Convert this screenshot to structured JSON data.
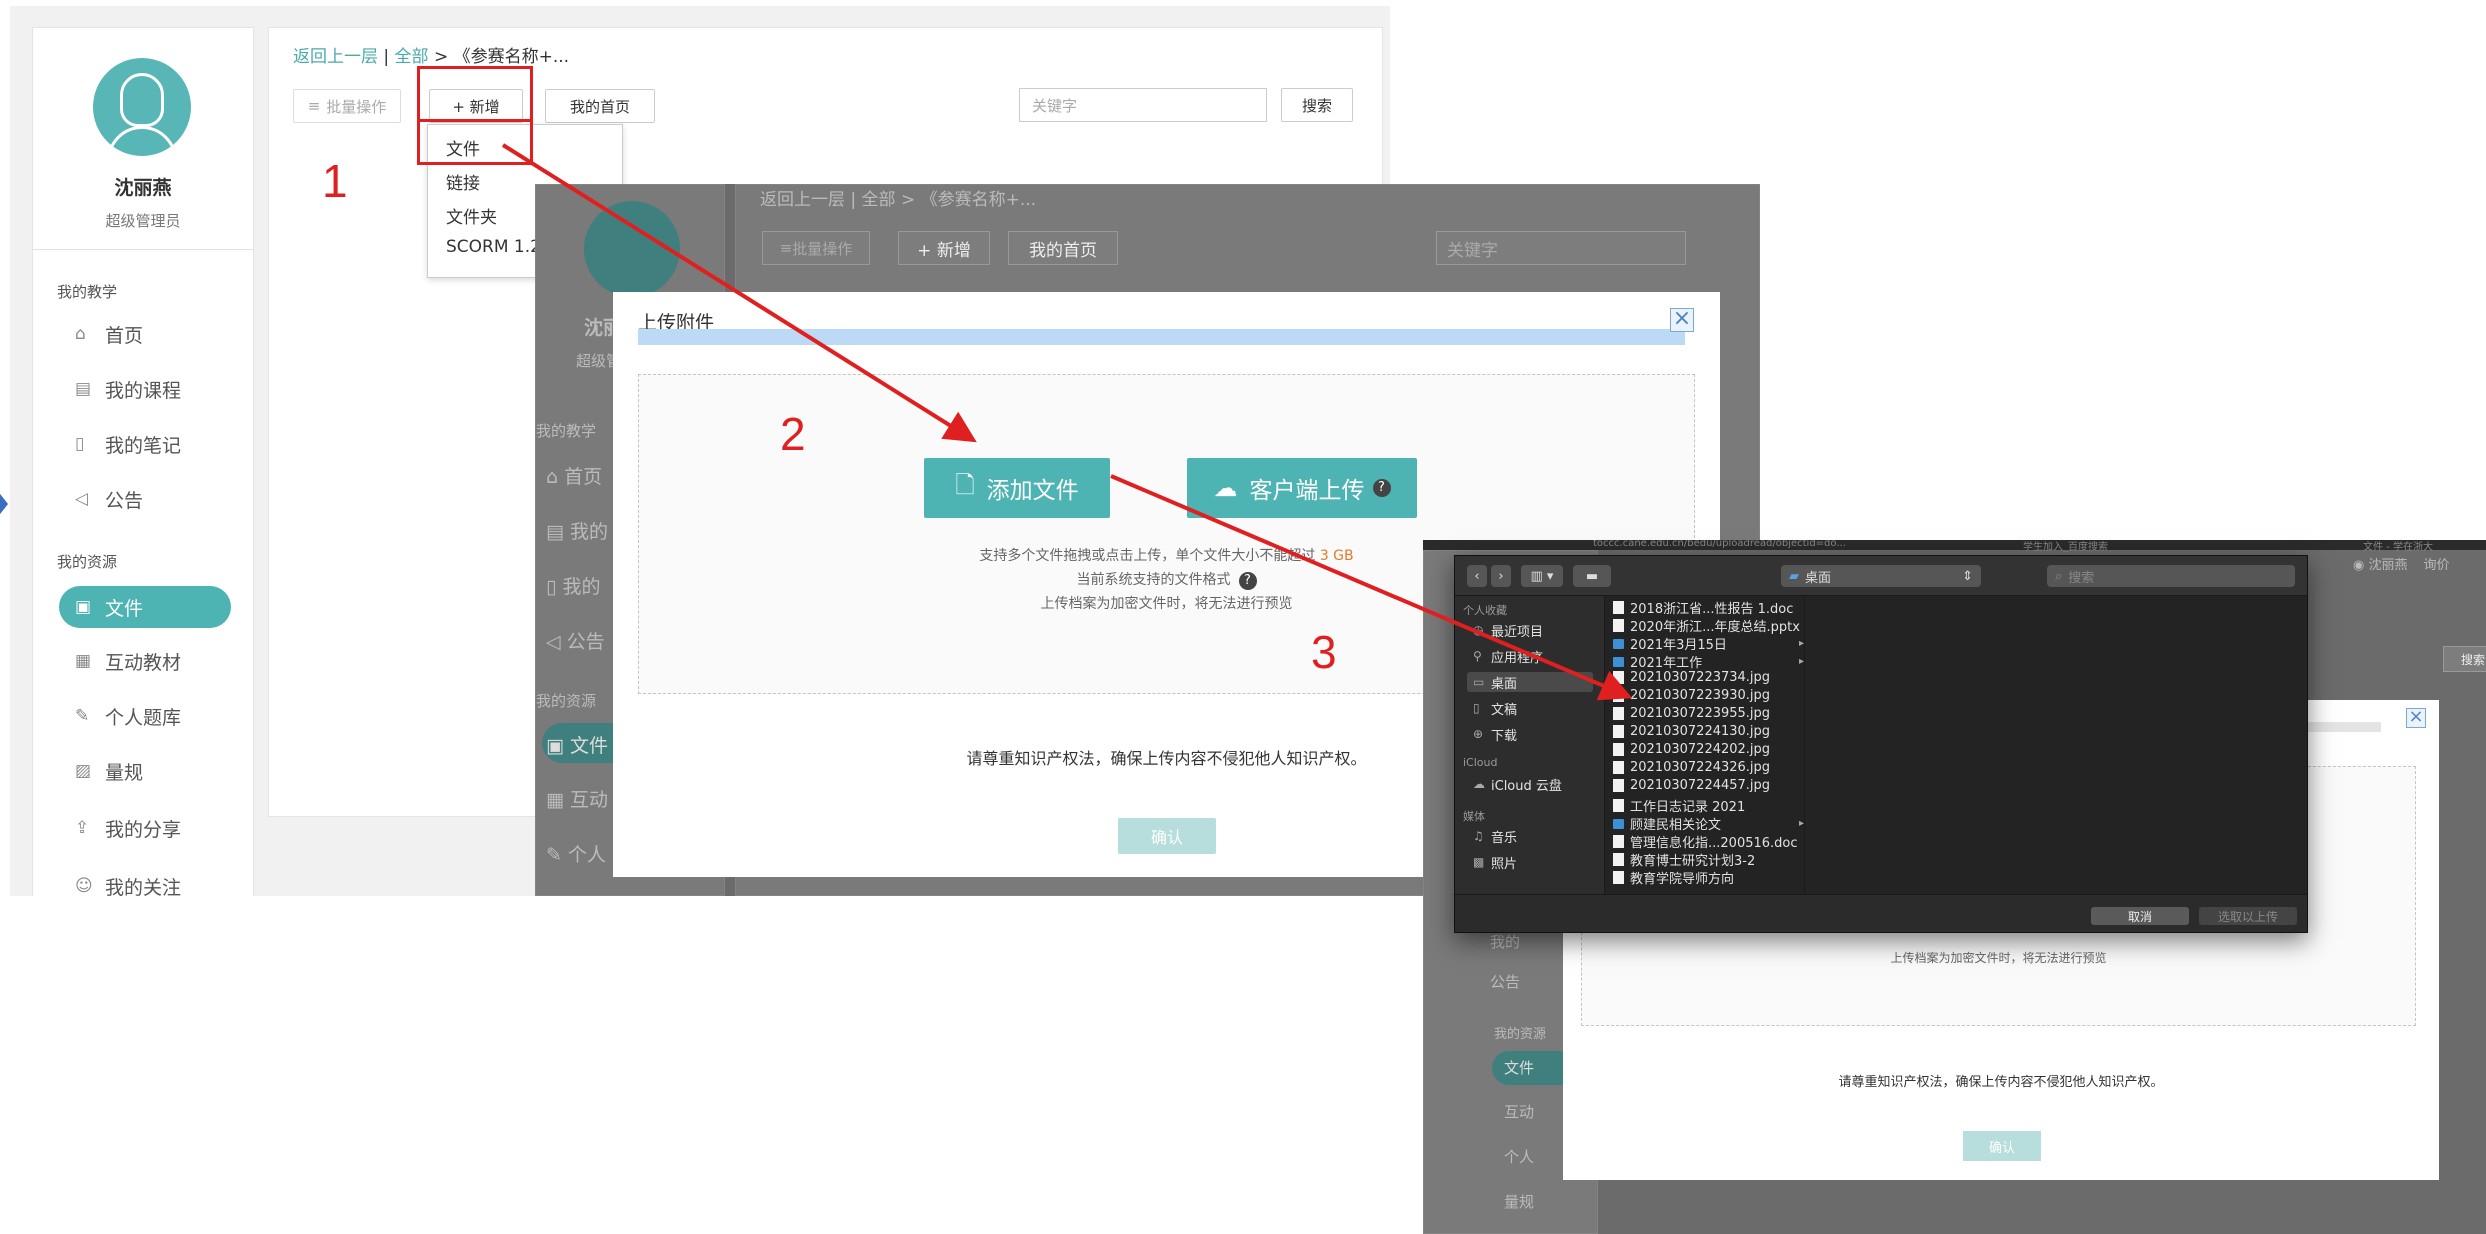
{
  "panel1": {
    "user": {
      "name": "沈丽燕",
      "role": "超级管理员"
    },
    "sidebar": {
      "group_teaching": "我的教学",
      "teaching_items": [
        {
          "label": "首页",
          "icon": "home-icon"
        },
        {
          "label": "我的课程",
          "icon": "course-icon"
        },
        {
          "label": "我的笔记",
          "icon": "notebook-icon"
        },
        {
          "label": "公告",
          "icon": "megaphone-icon"
        }
      ],
      "group_resources": "我的资源",
      "resource_items": [
        {
          "label": "文件",
          "icon": "file-icon",
          "active": true
        },
        {
          "label": "互动教材",
          "icon": "textbook-icon"
        },
        {
          "label": "个人题库",
          "icon": "question-bank-icon"
        },
        {
          "label": "量规",
          "icon": "rubric-icon"
        },
        {
          "label": "我的分享",
          "icon": "share-icon"
        },
        {
          "label": "我的关注",
          "icon": "follow-icon"
        }
      ]
    },
    "breadcrumb": {
      "back": "返回上一层",
      "sep1": "|",
      "all": "全部",
      "sep2": ">",
      "current": "《参赛名称+..."
    },
    "toolbar": {
      "batch": "批量操作",
      "add": "+ 新增",
      "home": "我的首页",
      "search_placeholder": "关键字",
      "search": "搜索"
    },
    "dropdown": [
      "文件",
      "链接",
      "文件夹",
      "SCORM 1.2"
    ]
  },
  "steps": [
    "1",
    "2",
    "3"
  ],
  "panel2": {
    "breadcrumb": {
      "back": "返回上一层",
      "sep1": "|",
      "all": "全部",
      "sep2": ">",
      "current": "《参赛名称+..."
    },
    "toolbar": {
      "batch": "批量操作",
      "add": "+ 新增",
      "home": "我的首页",
      "search_placeholder": "关键字"
    },
    "sidebar_fragments": {
      "name": "沈丽",
      "role": "超级管",
      "group_teaching": "我的教学",
      "items": [
        "首页",
        "我的",
        "我的",
        "公告"
      ],
      "group_resources": "我的资源",
      "res_items": [
        "文件",
        "互动",
        "个人"
      ]
    },
    "modal": {
      "title": "上传附件",
      "close": "×",
      "add_file": "添加文件",
      "client_upload": "客户端上传",
      "hint1_a": "支持多个文件拖拽或点击上传，单个文件大小不能超过 ",
      "hint1_b": "3 GB",
      "hint2": "当前系统支持的文件格式",
      "hint3": "上传档案为加密文件时，将无法进行预览",
      "notice": "请尊重知识产权法，确保上传内容不侵犯他人知识产权。",
      "confirm": "确认"
    }
  },
  "panel3": {
    "tab_fragments": [
      "toccc.cane.edu.cn/bedu/uploadread/objectid=do...",
      "学生加入_百度搜索",
      "文件 - 学在浙大"
    ],
    "user_chip": "沈丽燕",
    "user_chip_tail": "询价",
    "search_btn_frag": "搜索",
    "sidebar_fragments": {
      "items": [
        "我的",
        "公告"
      ],
      "group_resources": "我的资源",
      "res_items": [
        "文件",
        "互动",
        "个人",
        "量规"
      ]
    },
    "modal": {
      "hint3": "上传档案为加密文件时，将无法进行预览",
      "notice": "请尊重知识产权法，确保上传内容不侵犯他人知识产权。",
      "confirm": "确认"
    }
  },
  "file_picker": {
    "location": "桌面",
    "search_placeholder": "搜索",
    "sidebar": {
      "favorites_header": "个人收藏",
      "favorites": [
        {
          "label": "最近项目",
          "icon": "clock-icon"
        },
        {
          "label": "应用程序",
          "icon": "apps-icon"
        },
        {
          "label": "桌面",
          "icon": "desktop-icon",
          "selected": true
        },
        {
          "label": "文稿",
          "icon": "document-icon"
        },
        {
          "label": "下载",
          "icon": "download-icon"
        }
      ],
      "icloud_header": "iCloud",
      "icloud": [
        {
          "label": "iCloud 云盘",
          "icon": "cloud-icon"
        }
      ],
      "media_header": "媒体",
      "media": [
        {
          "label": "音乐",
          "icon": "music-icon"
        },
        {
          "label": "照片",
          "icon": "photo-icon"
        }
      ]
    },
    "files": [
      {
        "name": "2018浙江省...性报告 1.doc",
        "type": "doc"
      },
      {
        "name": "2020年浙江...年度总结.pptx",
        "type": "doc"
      },
      {
        "name": "2021年3月15日",
        "type": "folder"
      },
      {
        "name": "2021年工作",
        "type": "folder"
      },
      {
        "name": "20210307223734.jpg",
        "type": "img"
      },
      {
        "name": "20210307223930.jpg",
        "type": "img"
      },
      {
        "name": "20210307223955.jpg",
        "type": "img"
      },
      {
        "name": "20210307224130.jpg",
        "type": "img"
      },
      {
        "name": "20210307224202.jpg",
        "type": "img"
      },
      {
        "name": "20210307224326.jpg",
        "type": "img"
      },
      {
        "name": "20210307224457.jpg",
        "type": "img"
      },
      {
        "name": "工作日志记录 2021",
        "type": "doc"
      },
      {
        "name": "顾建民相关论文",
        "type": "folder"
      },
      {
        "name": "管理信息化指...200516.doc",
        "type": "doc"
      },
      {
        "name": "教育博士研究计划3-2",
        "type": "doc"
      },
      {
        "name": "教育学院导师方向",
        "type": "doc"
      }
    ],
    "cancel": "取消",
    "choose": "选取以上传"
  },
  "colors": {
    "teal": "#4db3b3",
    "red": "#e02020",
    "orange": "#e07b2a"
  }
}
